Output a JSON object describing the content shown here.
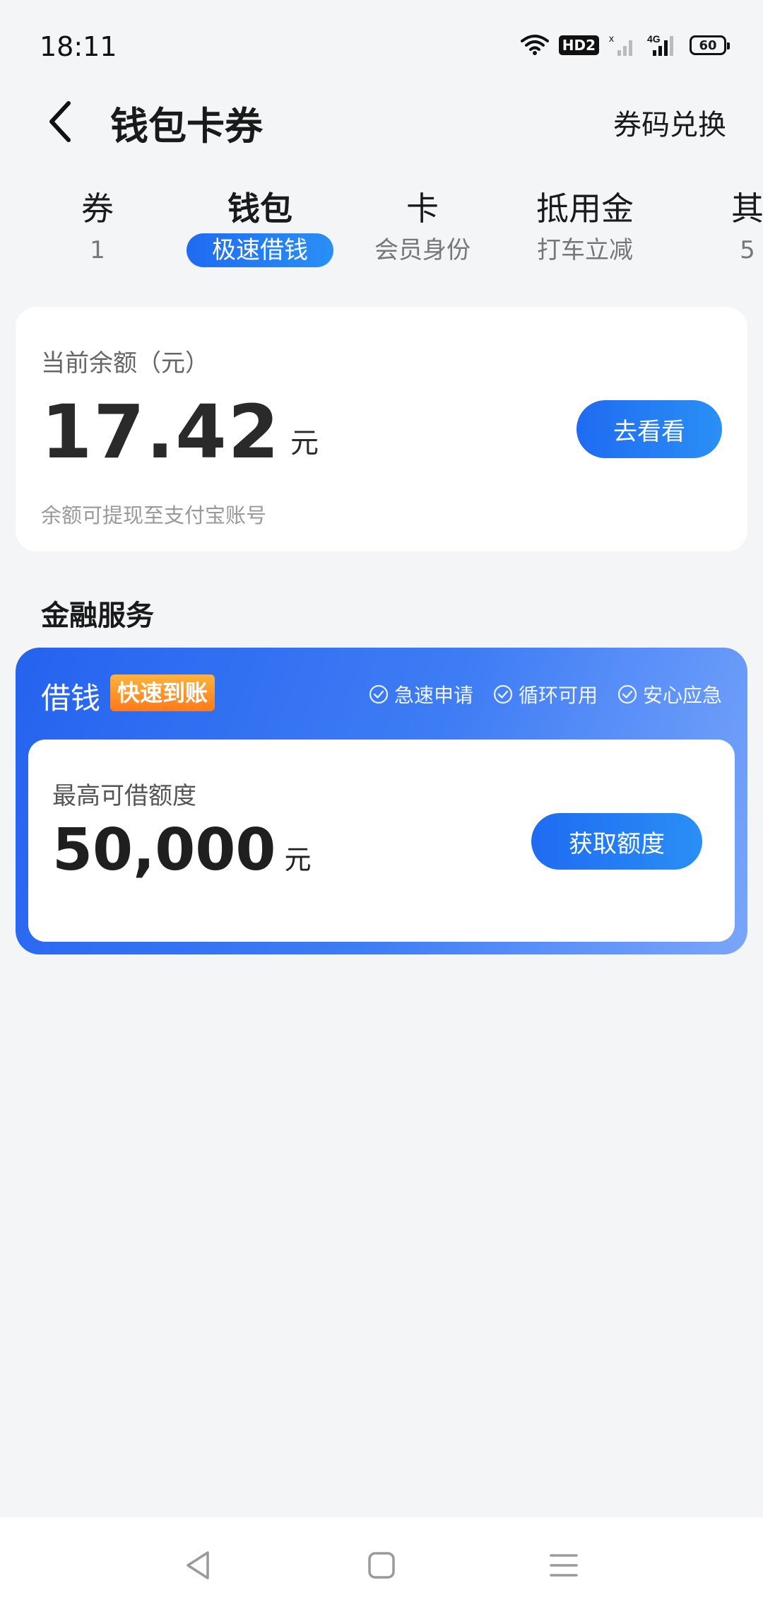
{
  "status_bar": {
    "time": "18:11",
    "hd_badge": "HD2",
    "network": "4G",
    "battery": "60"
  },
  "header": {
    "title": "钱包卡券",
    "redeem_label": "券码兑换"
  },
  "tabs": [
    {
      "title": "券",
      "sub": "1"
    },
    {
      "title": "钱包",
      "sub": "极速借钱",
      "active": true
    },
    {
      "title": "卡",
      "sub": "会员身份"
    },
    {
      "title": "抵用金",
      "sub": "打车立减"
    },
    {
      "title": "其",
      "sub": "5"
    }
  ],
  "balance": {
    "label": "当前余额（元）",
    "value": "17.42",
    "unit": "元",
    "button": "去看看",
    "note": "余额可提现至支付宝账号"
  },
  "finance": {
    "section_title": "金融服务",
    "loan_title": "借钱",
    "loan_tag": "快速到账",
    "features": [
      "急速申请",
      "循环可用",
      "安心应急"
    ],
    "limit_label": "最高可借额度",
    "limit_value": "50,000",
    "limit_unit": "元",
    "button": "获取额度"
  },
  "colors": {
    "accent": "#1f6bf2",
    "background": "#f4f5f7",
    "tag_orange": "#ff8a1f"
  },
  "icons": [
    "back-arrow-icon",
    "wifi-icon",
    "signal-icon",
    "check-circle-icon",
    "nav-back-icon",
    "nav-home-icon",
    "nav-menu-icon"
  ]
}
